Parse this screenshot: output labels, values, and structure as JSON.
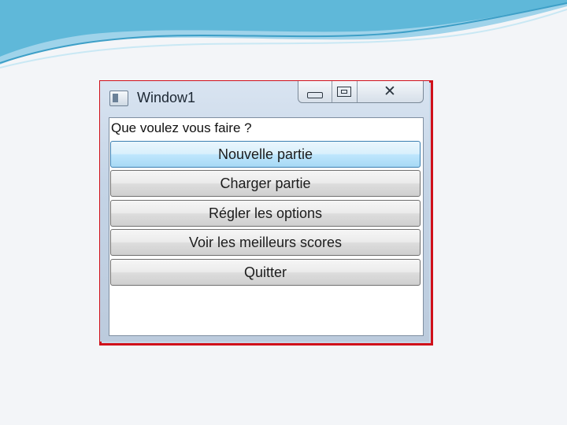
{
  "window": {
    "title": "Window1",
    "controls": [
      "minimize",
      "maximize",
      "close"
    ],
    "close_glyph": "✕"
  },
  "dialog": {
    "prompt": "Que voulez vous faire ?",
    "buttons": [
      {
        "label": "Nouvelle partie",
        "state": "focused"
      },
      {
        "label": "Charger partie",
        "state": "normal"
      },
      {
        "label": "Régler les options",
        "state": "normal"
      },
      {
        "label": "Voir les meilleurs scores",
        "state": "normal"
      },
      {
        "label": "Quitter",
        "state": "normal"
      }
    ]
  },
  "colors": {
    "highlight_frame": "#d0101a",
    "focused_button": "#bee6fd",
    "banner": "#5fb8d9"
  }
}
